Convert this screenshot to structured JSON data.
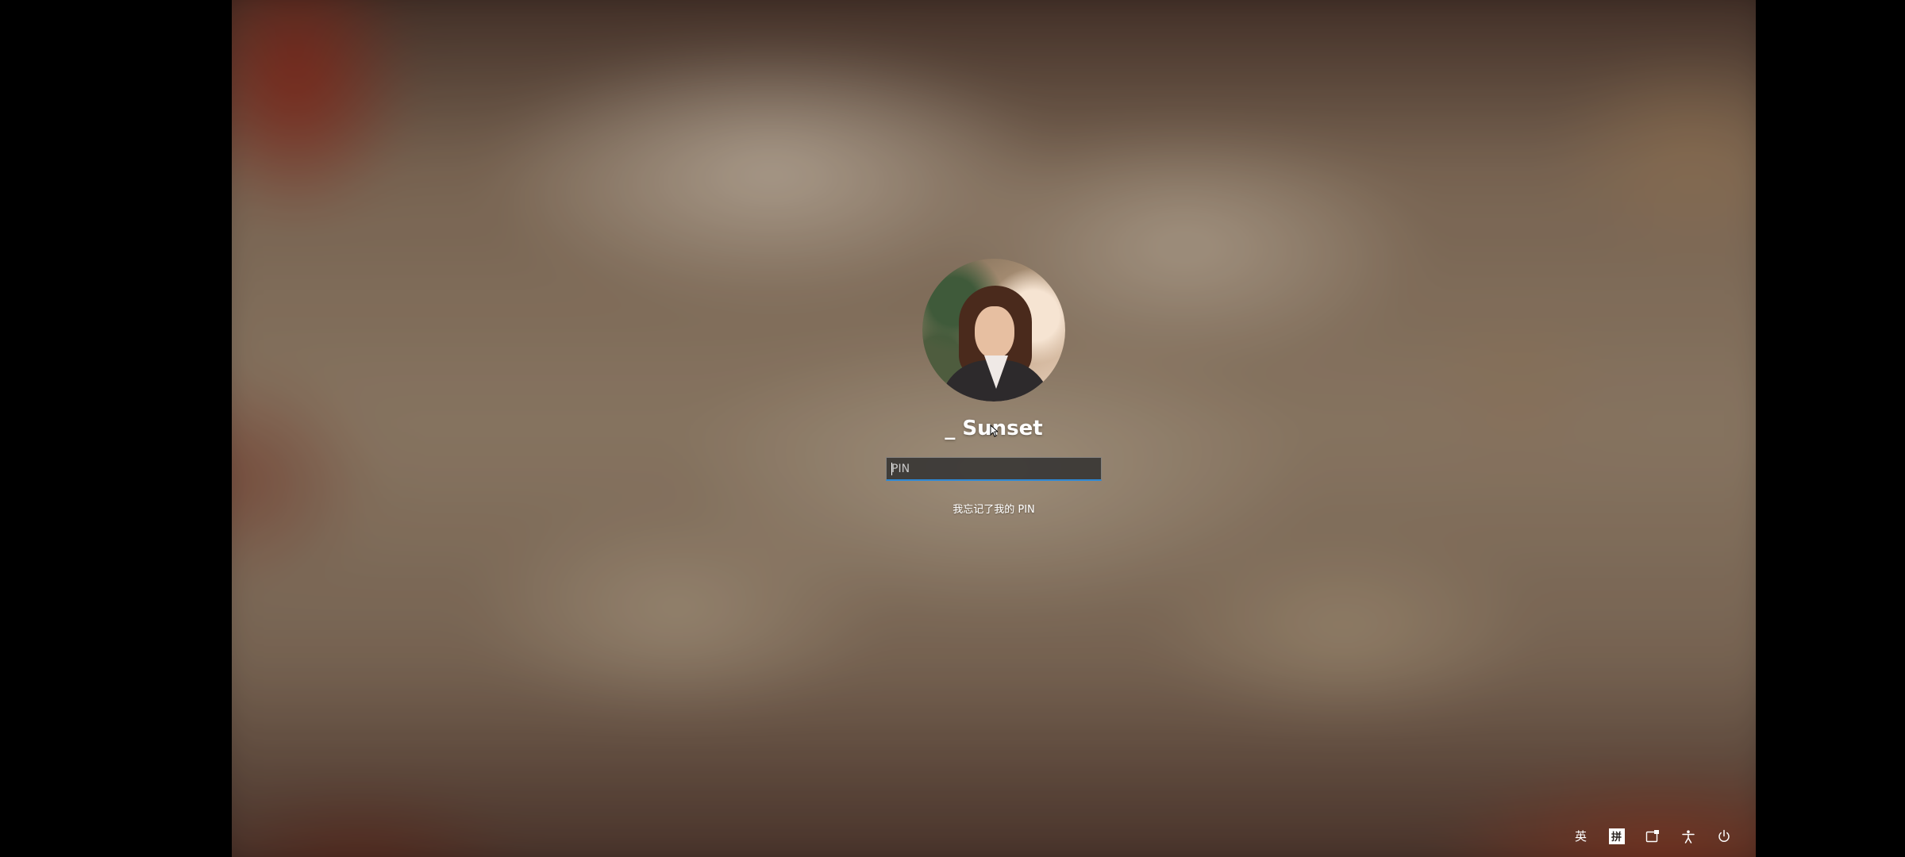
{
  "user": {
    "name": "_ Sunset"
  },
  "pin": {
    "placeholder": "PIN",
    "value": ""
  },
  "forgot_pin": {
    "label": "我忘记了我的 PIN"
  },
  "tray": {
    "input_language": "英",
    "ime_mode": "拼",
    "icons": [
      "network-icon",
      "accessibility-icon",
      "power-icon"
    ]
  },
  "colors": {
    "accent": "#2e8ad6",
    "text": "#ffffff",
    "input_background": "#2d2d2d"
  }
}
